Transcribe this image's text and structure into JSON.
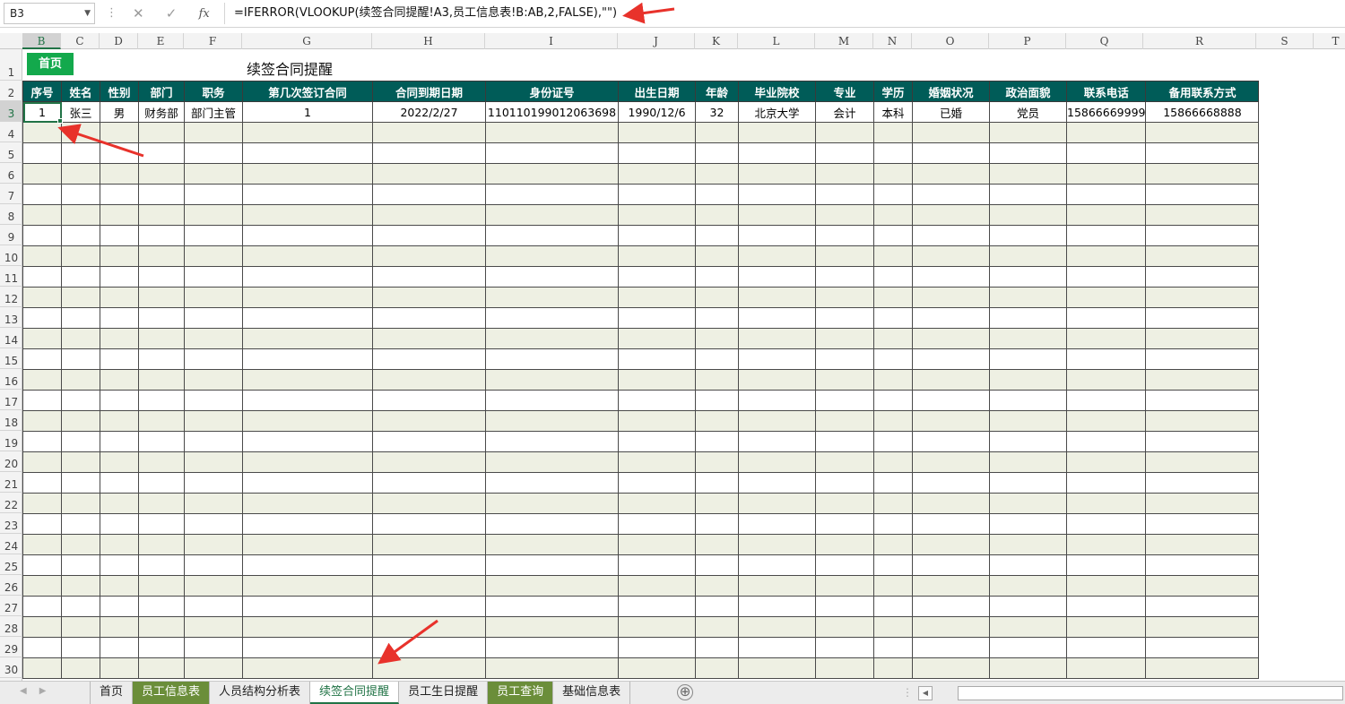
{
  "formula_bar": {
    "name_box": "B3",
    "cancel_icon": "✕",
    "enter_icon": "✓",
    "fx_label": "fx",
    "formula": "=IFERROR(VLOOKUP(续签合同提醒!A3,员工信息表!B:AB,2,FALSE),\"\")"
  },
  "column_letters": [
    "B",
    "C",
    "D",
    "E",
    "F",
    "G",
    "H",
    "I",
    "J",
    "K",
    "L",
    "M",
    "N",
    "O",
    "P",
    "Q",
    "R",
    "S",
    "T"
  ],
  "selected_column": "B",
  "row_numbers": [
    "1",
    "2",
    "3",
    "4",
    "5",
    "6",
    "7",
    "8",
    "9",
    "10",
    "11",
    "12",
    "13",
    "14",
    "15",
    "16",
    "17",
    "18",
    "19",
    "20",
    "21",
    "22",
    "23",
    "24",
    "25",
    "26",
    "27",
    "28",
    "29",
    "30"
  ],
  "selected_row": "3",
  "sheet": {
    "home_button": "首页",
    "title": "续签合同提醒",
    "headers": [
      "序号",
      "姓名",
      "性别",
      "部门",
      "职务",
      "第几次签订合同",
      "合同到期日期",
      "身份证号",
      "出生日期",
      "年龄",
      "毕业院校",
      "专业",
      "学历",
      "婚姻状况",
      "政治面貌",
      "联系电话",
      "备用联系方式"
    ],
    "rows": [
      [
        "1",
        "张三",
        "男",
        "财务部",
        "部门主管",
        "1",
        "2022/2/27",
        "110110199012063698",
        "1990/12/6",
        "32",
        "北京大学",
        "会计",
        "本科",
        "已婚",
        "党员",
        "15866669999",
        "15866668888"
      ]
    ],
    "empty_rows": 27,
    "accent_header": "#005c58",
    "band_color": "#eef0e3",
    "home_button_color": "#13a94c"
  },
  "tabs": [
    {
      "label": "首页",
      "style": "normal"
    },
    {
      "label": "员工信息表",
      "style": "green"
    },
    {
      "label": "人员结构分析表",
      "style": "normal"
    },
    {
      "label": "续签合同提醒",
      "style": "active"
    },
    {
      "label": "员工生日提醒",
      "style": "normal"
    },
    {
      "label": "员工查询",
      "style": "green"
    },
    {
      "label": "基础信息表",
      "style": "normal"
    }
  ],
  "add_sheet_icon": "⊕"
}
